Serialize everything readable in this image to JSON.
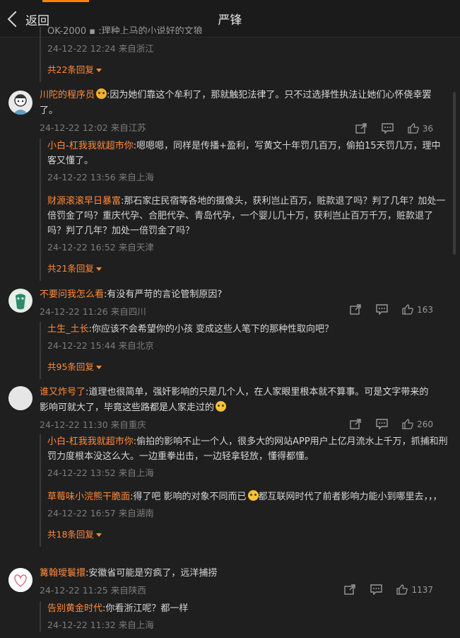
{
  "header": {
    "back_label": "返回",
    "title": "严锋"
  },
  "top_partial": {
    "text": "QK-2000 ▪ :理种上马的小说好的文狼",
    "meta": "24-12-22 12:24 来自浙江",
    "more": "共22条回复"
  },
  "comments": [
    {
      "name": "川陀的程序员",
      "text": ":因为她们靠这个牟利了，那就触犯法律了。只不过选择性执法让她们心怀侥幸罢了。",
      "meta": "24-12-22 12:02 来自江苏",
      "likes": "36",
      "replies": [
        {
          "name": "小白-杠我我就超市你",
          "text": ":嗯嗯嗯，同样是传播+盈利，写黄文十年罚几百万，偷拍15天罚几万，理中客又懂了。",
          "meta": "24-12-22 13:56 来自上海"
        },
        {
          "name": "财源滚滚早日暴富",
          "text": ":那石家庄民宿等各地的摄像头，获利岂止百万，赃款退了吗？判了几年？加处一倍罚金了吗？重庆代孕、合肥代孕、青岛代孕，一个婴儿几十万，获利岂止百万千万，赃款退了吗？判了几年？加处一倍罚金了吗？",
          "meta": "24-12-22 16:52 来自天津"
        }
      ],
      "more": "共21条回复"
    },
    {
      "name": "不要问我怎么看",
      "text": ":有没有严苛的言论管制原因?",
      "meta": "24-12-22 11:26 来自四川",
      "likes": "163",
      "replies": [
        {
          "name": "土生_土长",
          "text": ":你应该不会希望你的小孩 变成这些人笔下的那种性取向吧？",
          "meta": "24-12-22 15:44 来自北京"
        }
      ],
      "more": "共95条回复"
    },
    {
      "name": "谁又炸号了",
      "text": ":道理也很简单，强奸影响的只是几个人，在人家眼里根本就不算事。可是文字带来的影响可就大了，毕竟这些路都是人家走过的",
      "meta": "24-12-22 11:30 来自重庆",
      "likes": "260",
      "replies": [
        {
          "name": "小白-杠我我就超市你",
          "text": ":偷拍的影响不止一个人，很多大的网站APP用户上亿月流水上千万，抓捕和刑罚力度根本没这么大。一边重拳出击，一边轻拿轻放，懂得都懂。",
          "meta": "24-12-22 13:52 来自上海"
        },
        {
          "name": "草莓味小浣熊干脆面",
          "text": ":得了吧 影响的对象不同而已",
          "text2": "都互联网时代了前者影响力能小到哪里去，，，",
          "meta": "24-12-22 16:57 来自湖南"
        }
      ],
      "more": "共18条回复"
    },
    {
      "name": "篝翰璦鬟擐",
      "text": ":安徽省可能是穷疯了，远洋捕捞",
      "meta": "24-12-22 11:25 来自陕西",
      "likes": "1137",
      "replies": [
        {
          "name": "告别黄金时代",
          "text": ":你看浙江呢？都一样",
          "meta": "24-12-22 11:32 来自上海"
        }
      ]
    }
  ]
}
